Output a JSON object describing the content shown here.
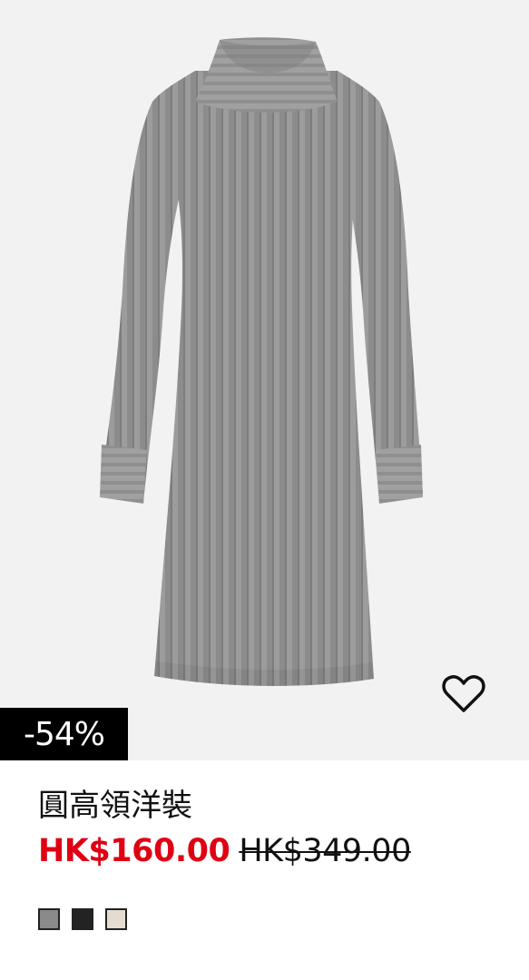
{
  "product": {
    "title": "圓高領洋裝",
    "discount_badge": "-54%",
    "sale_price": "HK$160.00",
    "original_price": "HK$349.00",
    "image_alt": "灰色坑紋針織高領洋裝",
    "favorite_icon": "heart-outline-icon"
  },
  "swatches": [
    {
      "name": "gray",
      "color": "#8a8a8a"
    },
    {
      "name": "black",
      "color": "#232323"
    },
    {
      "name": "beige",
      "color": "#e4dcd0"
    }
  ],
  "colors": {
    "sale_red": "#e00013",
    "image_background": "#f2f2f2",
    "garment_gray": "#9a9a9a"
  }
}
